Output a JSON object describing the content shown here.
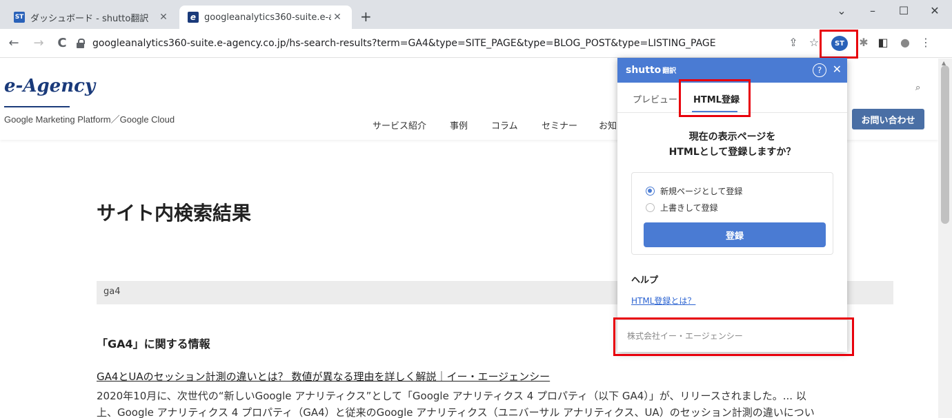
{
  "browser": {
    "tabs": [
      {
        "favicon": "ST",
        "title": "ダッシュボード - shutto翻訳",
        "active": false
      },
      {
        "favicon": "e",
        "title": "googleanalytics360-suite.e-agen",
        "active": true
      }
    ],
    "new_tab": "+",
    "window_controls": {
      "dropdown": "⌄",
      "minimize": "–",
      "maximize": "☐",
      "close": "✕"
    },
    "nav": {
      "back": "←",
      "forward": "→",
      "reload": "C"
    },
    "url": "googleanalytics360-suite.e-agency.co.jp/hs-search-results?term=GA4&type=SITE_PAGE&type=BLOG_POST&type=LISTING_PAGE",
    "toolbar_icons": {
      "share": "⇪",
      "bookmark": "☆",
      "extension": "ST",
      "puzzle": "✱",
      "sidepanel": "◧",
      "profile": "●",
      "menu": "⋮"
    }
  },
  "site": {
    "logo": "e-Agency",
    "tagline": "Google Marketing Platform／Google Cloud",
    "nav_items": [
      "サービス紹介",
      "事例",
      "コラム",
      "セミナー",
      "お知"
    ],
    "search_icon": "⌕",
    "contact_button": "お問い合わせ"
  },
  "main": {
    "title": "サイト内検索結果",
    "query": "ga4",
    "section_heading": "「GA4」に関する情報",
    "results": [
      {
        "title": "GA4とUAのセッション計測の違いとは？ 数値が異なる理由を詳しく解説｜イー・エージェンシー",
        "snippet_line1": "2020年10月に、次世代の“新しいGoogle アナリティクス”として「Google アナリティクス 4 プロパティ（以下 GA4）」が、リリースされました。... 以",
        "snippet_line2": "上、Google アナリティクス 4 プロパティ（GA4）と従来のGoogle アナリティクス（ユニバーサル アナリティクス、UA）のセッション計測の違いについ"
      }
    ]
  },
  "popup": {
    "brand": "shutto",
    "brand_suffix": "翻訳",
    "help_icon": "?",
    "close_icon": "✕",
    "tabs": [
      "プレビュー",
      "HTML登録"
    ],
    "active_tab": "HTML登録",
    "question_line1": "現在の表示ページを",
    "question_line2": "HTMLとして登録しますか？",
    "options": [
      "新規ページとして登録",
      "上書きして登録"
    ],
    "selected_option": "新規ページとして登録",
    "register_button": "登録",
    "help_heading": "ヘルプ",
    "help_link": "HTML登録とは？",
    "footer": "株式会社イー・エージェンシー"
  },
  "colors": {
    "highlight": "#e8000b",
    "popup_accent": "#4a7bd3",
    "site_brand": "#1a3a7a"
  }
}
